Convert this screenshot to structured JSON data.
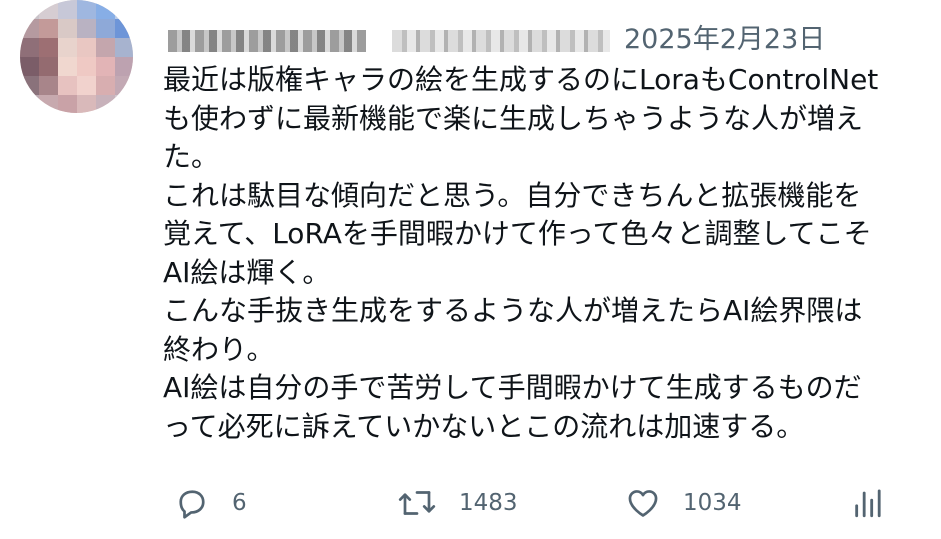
{
  "author": {
    "avatar_icon": "pixelated-avatar-icon",
    "name_redacted": true,
    "handle_redacted": true
  },
  "post": {
    "date": "2025年2月23日",
    "lines": [
      "最近は版権キャラの絵を生成するのにLoraもControlNet",
      "も使わずに最新機能で楽に生成しちゃうような人が増え",
      "た。",
      "これは駄目な傾向だと思う。自分できちんと拡張機能を",
      "覚えて、LoRAを手間暇かけて作って色々と調整してこそ",
      "AI絵は輝く。",
      "こんな手抜き生成をするような人が増えたらAI絵界隈は",
      "終わり。",
      "AI絵は自分の手で苦労して手間暇かけて生成するものだ",
      "って必死に訴えていかないとこの流れは加速する。"
    ]
  },
  "actions": {
    "reply": {
      "icon": "reply-icon",
      "count": "6"
    },
    "repost": {
      "icon": "repost-icon",
      "count": "1483"
    },
    "like": {
      "icon": "heart-icon",
      "count": "1034"
    },
    "views": {
      "icon": "analytics-icon"
    }
  },
  "colors": {
    "text": "#0f1419",
    "secondary": "#536471",
    "background": "#ffffff"
  }
}
